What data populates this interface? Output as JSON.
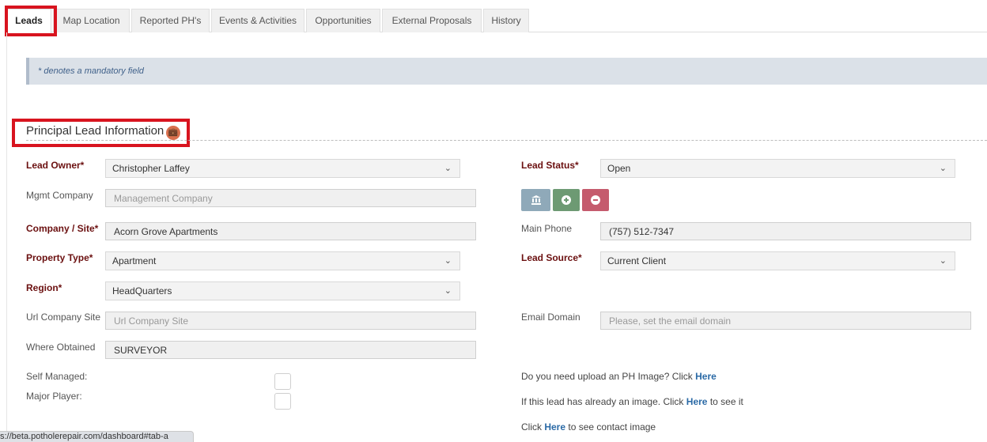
{
  "tabs": [
    {
      "label": "Leads"
    },
    {
      "label": "Map Location"
    },
    {
      "label": "Reported PH's"
    },
    {
      "label": "Events & Activities"
    },
    {
      "label": "Opportunities"
    },
    {
      "label": "External Proposals"
    },
    {
      "label": "History"
    }
  ],
  "notice": "* denotes a mandatory field",
  "section": {
    "title": "Principal Lead Information",
    "icon": "briefcase-icon"
  },
  "form": {
    "lead_owner": {
      "label": "Lead Owner*",
      "value": "Christopher Laffey"
    },
    "mgmt_company": {
      "label": "Mgmt Company",
      "placeholder": "Management Company"
    },
    "company_site": {
      "label": "Company / Site*",
      "value": "Acorn Grove Apartments"
    },
    "property_type": {
      "label": "Property Type*",
      "value": "Apartment"
    },
    "region": {
      "label": "Region*",
      "value": "HeadQuarters"
    },
    "url_company_site": {
      "label": "Url Company Site",
      "placeholder": "Url Company Site"
    },
    "where_obtained": {
      "label": "Where Obtained",
      "value": "SURVEYOR"
    },
    "self_managed": {
      "label": "Self Managed:"
    },
    "major_player": {
      "label": "Major Player:"
    },
    "lead_status": {
      "label": "Lead Status*",
      "value": "Open"
    },
    "main_phone": {
      "label": "Main Phone",
      "value": "(757) 512-7347"
    },
    "lead_source": {
      "label": "Lead Source*",
      "value": "Current Client"
    },
    "email_domain": {
      "label": "Email Domain",
      "placeholder": "Please, set the email domain"
    }
  },
  "actions": {
    "building_icon": "building-icon",
    "add_icon": "plus-circle-icon",
    "remove_icon": "minus-circle-icon",
    "colors": {
      "building": "#8fa9b9",
      "add": "#6d9a73",
      "remove": "#c55b6d"
    }
  },
  "links": {
    "upload_text": "Do you need upload an PH Image? Click",
    "upload_link": "Here",
    "image_text_before": "If this lead has already an image. Click",
    "image_link": "Here",
    "image_text_after": "to see it",
    "contact_text_before": "Click",
    "contact_link": "Here",
    "contact_text_after": "to see contact image"
  },
  "status_bar": "s://beta.potholerepair.com/dashboard#tab-a",
  "colors": {
    "highlight": "#d8141f",
    "required_label": "#6b1010",
    "link": "#2b6aa6"
  }
}
